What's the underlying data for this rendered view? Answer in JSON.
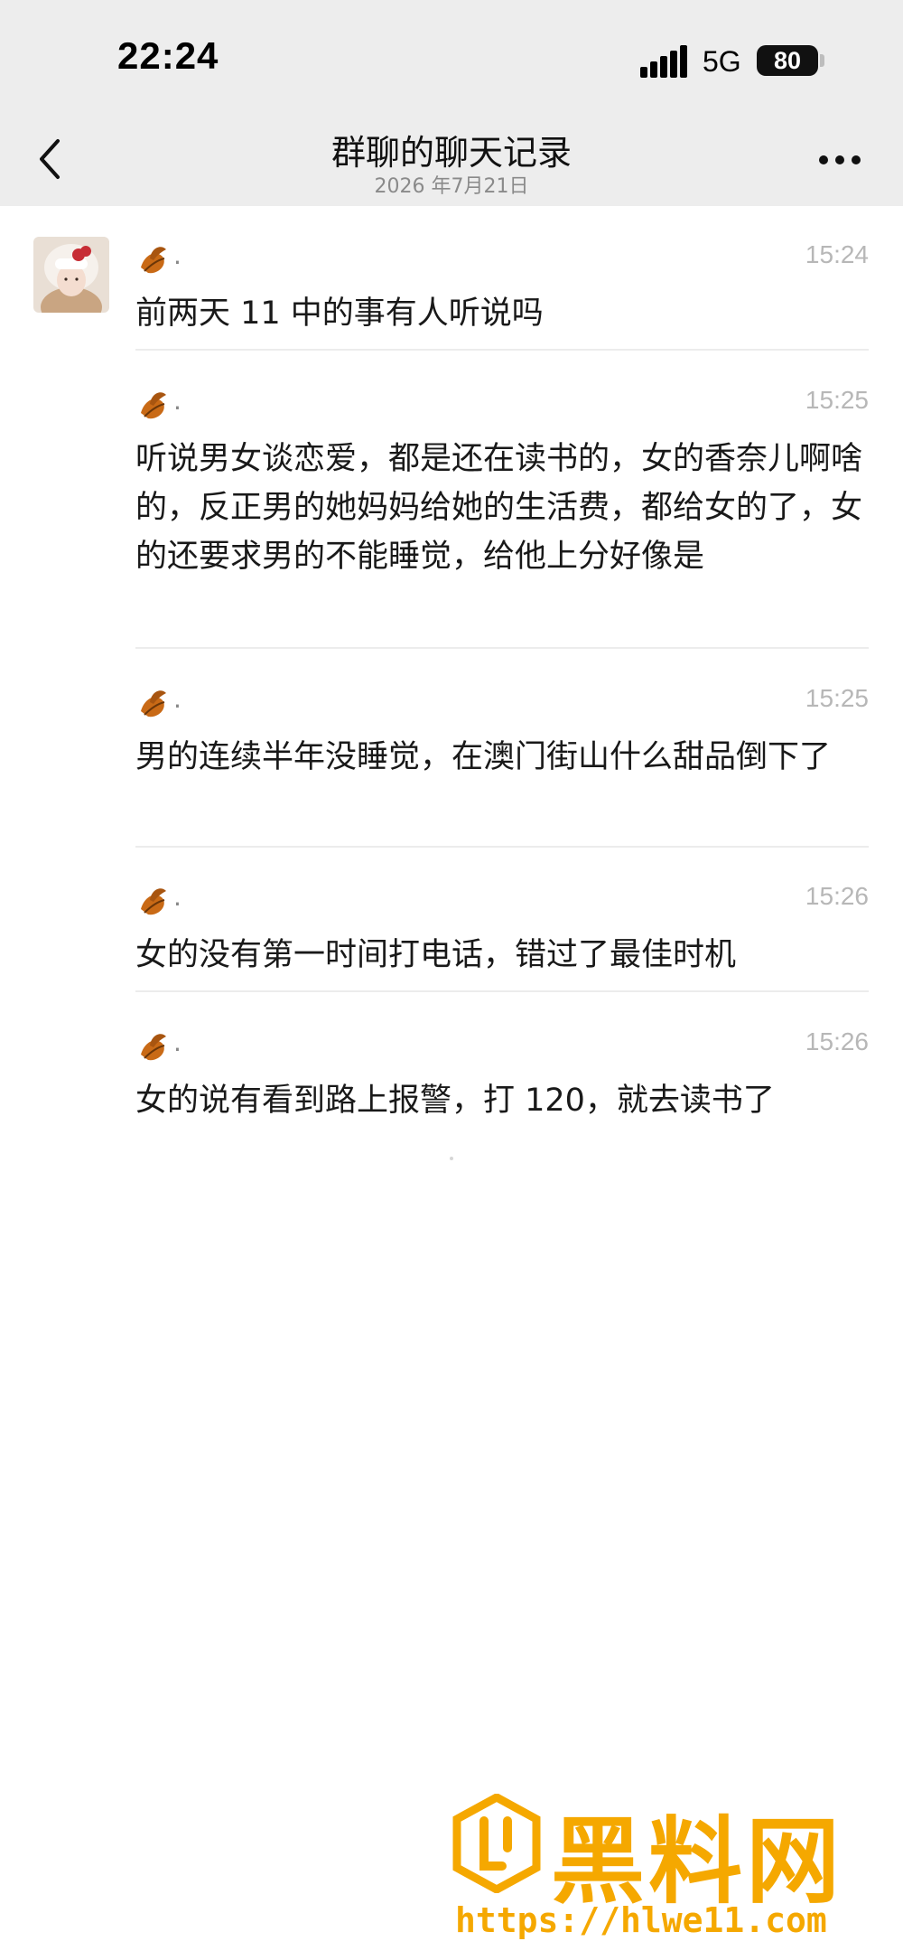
{
  "status_bar": {
    "time": "22:24",
    "network": "5G",
    "battery": "80"
  },
  "nav": {
    "title": "群聊的聊天记录",
    "subtitle": "2026 年7月21日"
  },
  "messages": [
    {
      "sender": ".",
      "time": "15:24",
      "text": "前两天 11 中的事有人听说吗"
    },
    {
      "sender": ".",
      "time": "15:25",
      "text": "听说男女谈恋爱，都是还在读书的，女的香奈儿啊啥的，反正男的她妈妈给她的生活费，都给女的了，女的还要求男的不能睡觉，给他上分好像是"
    },
    {
      "sender": ".",
      "time": "15:25",
      "text": "男的连续半年没睡觉，在澳门街山什么甜品倒下了"
    },
    {
      "sender": ".",
      "time": "15:26",
      "text": "女的没有第一时间打电话，错过了最佳时机"
    },
    {
      "sender": ".",
      "time": "15:26",
      "text": "女的说有看到路上报警，打 120，就去读书了"
    }
  ],
  "watermark": {
    "title": "黑料网",
    "url": "https://hlwe11.com"
  },
  "colors": {
    "bar_bg": "#ededed",
    "time_gray": "#b7b7b7",
    "watermark": "#f5a800"
  },
  "icons": [
    "back-icon",
    "more-icon",
    "signal-icon",
    "battery-icon",
    "sender-icon"
  ]
}
